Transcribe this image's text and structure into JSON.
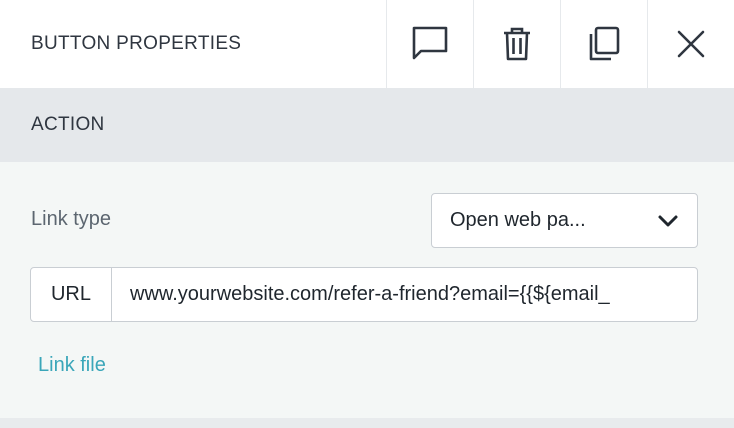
{
  "header": {
    "title": "BUTTON PROPERTIES",
    "actions": [
      {
        "icon": "comment-icon"
      },
      {
        "icon": "trash-icon"
      },
      {
        "icon": "duplicate-icon"
      },
      {
        "icon": "close-icon"
      }
    ]
  },
  "section": {
    "title": "ACTION",
    "link_type": {
      "label": "Link type",
      "selected": "Open web pa...",
      "icon": "chevron-down-icon"
    },
    "url": {
      "prefix": "URL",
      "value": "www.yourwebsite.com/refer-a-friend?email={{${email_"
    },
    "link_file_label": "Link file"
  },
  "colors": {
    "text": "#2f3640",
    "section_bg": "#e5e8eb",
    "body_bg": "#f4f7f6",
    "border": "#c9ced3",
    "link": "#3aa6b9"
  }
}
